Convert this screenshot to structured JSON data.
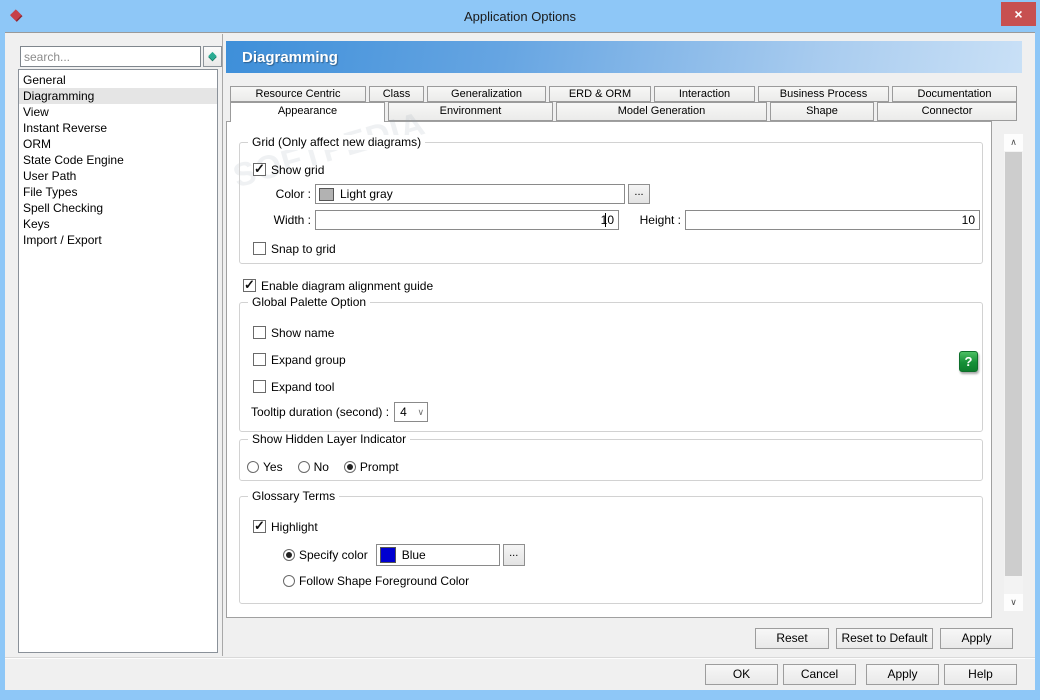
{
  "window": {
    "title": "Application Options"
  },
  "icons": {
    "app_diamond": "◆",
    "close": "×",
    "search_gem": "◆",
    "browse_ellipsis": "...",
    "dropdown_chevron": "∨",
    "scroll_up": "∧",
    "scroll_down": "∨",
    "help": "?"
  },
  "colors": {
    "titlebar": "#8ec7f7",
    "close_button": "#c75050",
    "header_gradient_left": "#3e8fd9",
    "header_gradient_right": "#c9e0f6",
    "help_green": "#169038",
    "grid_color_swatch": "#b2b2b2",
    "glossary_color_swatch": "#0000d0"
  },
  "watermark": "SOFTPEDIA",
  "sidebar": {
    "search_placeholder": "search...",
    "items": [
      {
        "label": "General",
        "selected": false
      },
      {
        "label": "Diagramming",
        "selected": true
      },
      {
        "label": "View",
        "selected": false
      },
      {
        "label": "Instant Reverse",
        "selected": false
      },
      {
        "label": "ORM",
        "selected": false
      },
      {
        "label": "State Code Engine",
        "selected": false
      },
      {
        "label": "User Path",
        "selected": false
      },
      {
        "label": "File Types",
        "selected": false
      },
      {
        "label": "Spell Checking",
        "selected": false
      },
      {
        "label": "Keys",
        "selected": false
      },
      {
        "label": "Import / Export",
        "selected": false
      }
    ]
  },
  "header": {
    "title": "Diagramming"
  },
  "tabs": {
    "row1": [
      {
        "label": "Resource Centric"
      },
      {
        "label": "Class"
      },
      {
        "label": "Generalization"
      },
      {
        "label": "ERD & ORM"
      },
      {
        "label": "Interaction"
      },
      {
        "label": "Business Process"
      },
      {
        "label": "Documentation"
      }
    ],
    "row2": [
      {
        "label": "Appearance",
        "selected": true
      },
      {
        "label": "Environment",
        "selected": false
      },
      {
        "label": "Model Generation",
        "selected": false
      },
      {
        "label": "Shape",
        "selected": false
      },
      {
        "label": "Connector",
        "selected": false
      }
    ]
  },
  "panel": {
    "grid": {
      "legend": "Grid (Only affect new diagrams)",
      "show_grid": {
        "label": "Show grid",
        "checked": true
      },
      "color": {
        "label": "Color :",
        "value": "Light gray"
      },
      "width": {
        "label": "Width :",
        "value": "10"
      },
      "height": {
        "label": "Height :",
        "value": "10"
      },
      "snap": {
        "label": "Snap to grid",
        "checked": false
      }
    },
    "alignment_guide": {
      "label": "Enable diagram alignment guide",
      "checked": true
    },
    "palette": {
      "legend": "Global Palette Option",
      "show_name": {
        "label": "Show name",
        "checked": false
      },
      "expand_group": {
        "label": "Expand group",
        "checked": false
      },
      "expand_tool": {
        "label": "Expand tool",
        "checked": false
      },
      "tooltip": {
        "label": "Tooltip duration (second) :",
        "value": "4"
      }
    },
    "hidden_layer": {
      "legend": "Show Hidden Layer Indicator",
      "options": [
        {
          "label": "Yes",
          "selected": false
        },
        {
          "label": "No",
          "selected": false
        },
        {
          "label": "Prompt",
          "selected": true
        }
      ]
    },
    "glossary": {
      "legend": "Glossary Terms",
      "highlight": {
        "label": "Highlight",
        "checked": true
      },
      "specify_color": {
        "label": "Specify color",
        "selected": true,
        "value": "Blue"
      },
      "follow": {
        "label": "Follow Shape Foreground Color",
        "selected": false
      }
    }
  },
  "panel_buttons": {
    "reset": "Reset",
    "reset_default": "Reset to Default",
    "apply": "Apply"
  },
  "dialog_buttons": {
    "ok": "OK",
    "cancel": "Cancel",
    "apply": "Apply",
    "help": "Help"
  }
}
